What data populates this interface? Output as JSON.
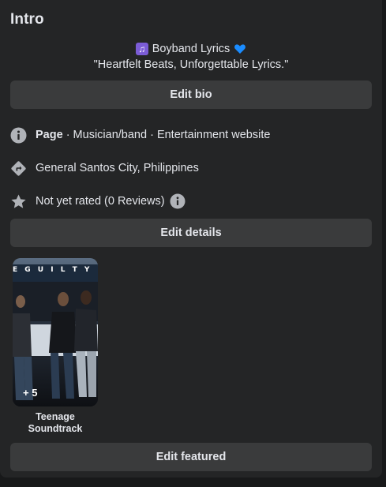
{
  "intro": {
    "title": "Intro",
    "bio_name": "Boyband Lyrics",
    "bio_tagline": "\"Heartfelt Beats, Unforgettable Lyrics.\"",
    "edit_bio_label": "Edit bio"
  },
  "details": {
    "category_bold": "Page",
    "category_rest": " · Musician/band · Entertainment website",
    "location": "General Santos City, Philippines",
    "rating": "Not yet rated (0 Reviews)",
    "edit_details_label": "Edit details"
  },
  "featured": {
    "collection_name": "Teenage Soundtrack",
    "extra_count": "+ 5",
    "banner_text": "E  G U I L T Y",
    "edit_featured_label": "Edit featured"
  },
  "icons": {
    "music": "music-notes-icon",
    "heart": "blue-heart-icon",
    "info": "info-icon",
    "directions": "directions-icon",
    "star": "star-icon",
    "info_small": "info-icon"
  },
  "colors": {
    "card_bg": "#242526",
    "page_bg": "#18191a",
    "button_bg": "#3a3b3c",
    "text_primary": "#e4e6eb",
    "icon_gray": "#b0b3b8",
    "heart_blue": "#1a8cff",
    "music_purple": "#7b5cd6"
  }
}
